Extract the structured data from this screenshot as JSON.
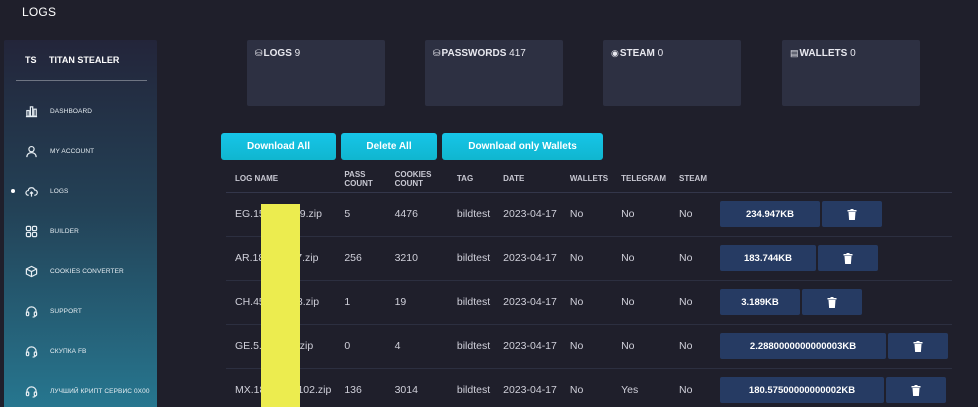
{
  "page": {
    "title": "LOGS"
  },
  "brand": {
    "short": "TS",
    "name": "TITAN STEALER"
  },
  "sidebar": {
    "items": [
      {
        "label": "DASHBOARD",
        "icon": "bar-chart-icon",
        "active": false
      },
      {
        "label": "MY ACCOUNT",
        "icon": "user-icon",
        "active": false
      },
      {
        "label": "LOGS",
        "icon": "cloud-icon",
        "active": true
      },
      {
        "label": "BUILDER",
        "icon": "grid-icon",
        "active": false
      },
      {
        "label": "COOKIES CONVERTER",
        "icon": "cube-icon",
        "active": false
      },
      {
        "label": "SUPPORT",
        "icon": "headset-icon",
        "active": false
      },
      {
        "label": "СКУПКА FB",
        "icon": "headset-icon",
        "active": false
      },
      {
        "label": "ЛУЧШИЙ КРИПТ СЕРВИС 0X00",
        "icon": "headset-icon",
        "active": false
      }
    ]
  },
  "stats": [
    {
      "icon": "database-icon",
      "label": "LOGS",
      "value": "9"
    },
    {
      "icon": "database-icon",
      "label": "PASSWORDS",
      "value": "417"
    },
    {
      "icon": "steam-icon",
      "label": "STEAM",
      "value": "0"
    },
    {
      "icon": "wallet-icon",
      "label": "WALLETS",
      "value": "0"
    }
  ],
  "actions": {
    "download_all": "Download All",
    "delete_all": "Delete All",
    "download_wallets": "Download only Wallets"
  },
  "table": {
    "columns": [
      "LOG NAME",
      "PASS COUNT",
      "COOKIES COUNT",
      "TAG",
      "DATE",
      "WALLETS",
      "TELEGRAM",
      "STEAM"
    ],
    "rows": [
      {
        "name": "EG.156          9.zip",
        "pass": "5",
        "cookies": "4476",
        "tag": "bildtest",
        "date": "2023-04-17",
        "wallets": "No",
        "telegram": "No",
        "steam": "No",
        "size": "234.947KB"
      },
      {
        "name": "AR.186         7.zip",
        "pass": "256",
        "cookies": "3210",
        "tag": "bildtest",
        "date": "2023-04-17",
        "wallets": "No",
        "telegram": "No",
        "steam": "No",
        "size": "183.744KB"
      },
      {
        "name": "CH.45           8.zip",
        "pass": "1",
        "cookies": "19",
        "tag": "bildtest",
        "date": "2023-04-17",
        "wallets": "No",
        "telegram": "No",
        "steam": "No",
        "size": "3.189KB"
      },
      {
        "name": "GE.5.1          .zip",
        "pass": "0",
        "cookies": "4",
        "tag": "bildtest",
        "date": "2023-04-17",
        "wallets": "No",
        "telegram": "No",
        "steam": "No",
        "size": "2.2880000000000003KB"
      },
      {
        "name": "MX.189         102.zip",
        "pass": "136",
        "cookies": "3014",
        "tag": "bildtest",
        "date": "2023-04-17",
        "wallets": "No",
        "telegram": "Yes",
        "steam": "No",
        "size": "180.57500000000002KB"
      }
    ]
  },
  "colors": {
    "background": "#1f1f2b",
    "card": "#2d3042",
    "accent": "#16c5e8",
    "size_button": "#263b63",
    "redaction": "#ecec4f"
  }
}
